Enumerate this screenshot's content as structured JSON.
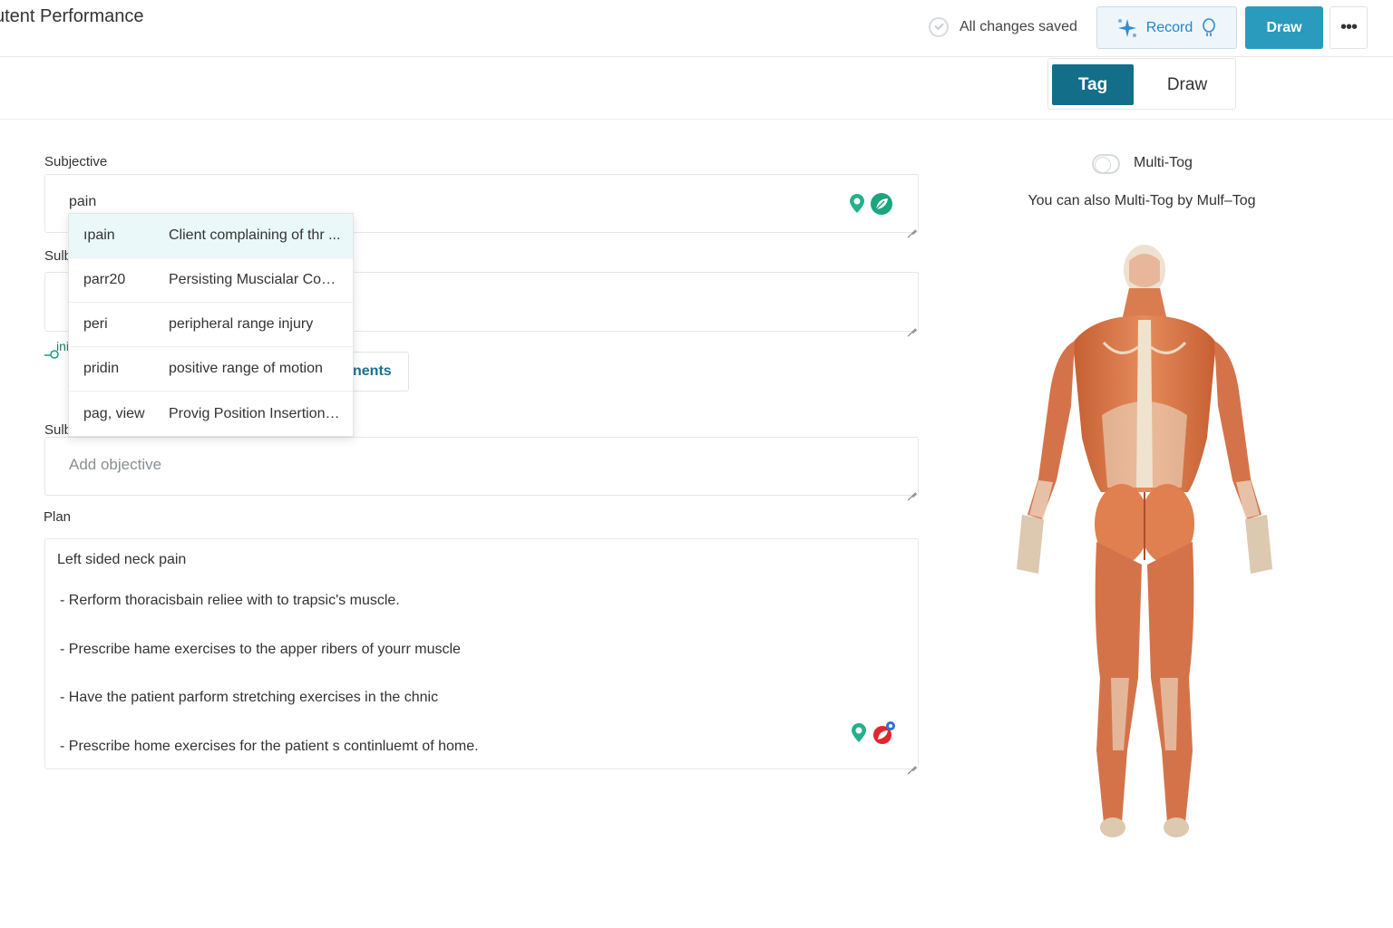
{
  "header": {
    "title": "utent Performance",
    "saved_status": "All changes saved",
    "record_label": "Record",
    "draw_label": "Draw",
    "more_label": "•••"
  },
  "mode_toggle": {
    "tag_label": "Tag",
    "draw_label": "Draw",
    "selected": "Tag"
  },
  "form": {
    "subjective_label": "Subjective",
    "subjective_value": "pain",
    "second_label": "Sulb",
    "third_label": "Sulb",
    "objective_placeholder": "Add objective",
    "partial_link_text": "ini",
    "partial_button_label": "nents",
    "plan_label": "Plan",
    "plan_lines": [
      "Left sided neck pain",
      "- Rerform thoracisbain reliee with to trapsic's muscle.",
      "- Prescribe hame exercises to the apper ribers of yourr muscle",
      "- Have the patient parform stretching exercises in the chnic",
      "- Prescribe home exercises for the patient s continluemt of home."
    ]
  },
  "autocomplete": [
    {
      "key": "ıpain",
      "value": "Client complaining of thr ..."
    },
    {
      "key": "parr20",
      "value": "Persisting Muscialar Coc...."
    },
    {
      "key": "peri",
      "value": "peripheral range injury"
    },
    {
      "key": "pridin",
      "value": "positive range of motion"
    },
    {
      "key": "pag, view",
      "value": "Provig Position Insertion...."
    }
  ],
  "right_panel": {
    "multi_tag_label": "Multi-Tog",
    "multi_tag_on": false,
    "hint": "You can also Multi-Tog by Mulf–Tog"
  },
  "colors": {
    "primary": "#2a9bbd",
    "primary_dark": "#136e8a",
    "record_text": "#1f86c7",
    "muscle": "#d9784a",
    "tendon": "#efe3cf"
  }
}
